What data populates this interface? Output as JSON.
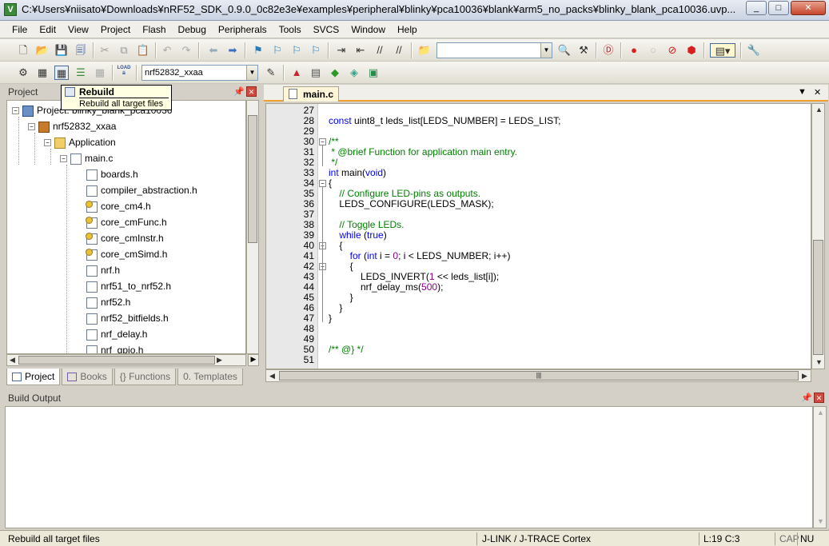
{
  "window": {
    "title": "C:¥Users¥niisato¥Downloads¥nRF52_SDK_0.9.0_0c82e3e¥examples¥peripheral¥blinky¥pca10036¥blank¥arm5_no_packs¥blinky_blank_pca10036.uvp...",
    "app_icon_letter": "V",
    "minimize": "_",
    "maximize": "□",
    "close": "✕"
  },
  "menu": [
    "File",
    "Edit",
    "View",
    "Project",
    "Flash",
    "Debug",
    "Peripherals",
    "Tools",
    "SVCS",
    "Window",
    "Help"
  ],
  "toolbar2": {
    "target_value": "nrf52832_xxaa",
    "load_label": "LOAD"
  },
  "tooltip": {
    "title": "Rebuild",
    "description": "Rebuild all target files"
  },
  "project_pane": {
    "title": "Project",
    "tree": [
      {
        "label": "Project: blinky_blank_pca10036",
        "icon": "project-icon",
        "level": 0,
        "expander": "−"
      },
      {
        "label": "nrf52832_xxaa",
        "icon": "target-icon",
        "level": 1,
        "expander": "−"
      },
      {
        "label": "Application",
        "icon": "folder-icon",
        "level": 2,
        "expander": "−"
      },
      {
        "label": "main.c",
        "icon": "file-icon",
        "level": 3,
        "expander": "−"
      },
      {
        "label": "boards.h",
        "icon": "file-icon",
        "level": 4
      },
      {
        "label": "compiler_abstraction.h",
        "icon": "file-icon",
        "level": 4
      },
      {
        "label": "core_cm4.h",
        "icon": "key-file-icon",
        "level": 4
      },
      {
        "label": "core_cmFunc.h",
        "icon": "key-file-icon",
        "level": 4
      },
      {
        "label": "core_cmInstr.h",
        "icon": "key-file-icon",
        "level": 4
      },
      {
        "label": "core_cmSimd.h",
        "icon": "key-file-icon",
        "level": 4
      },
      {
        "label": "nrf.h",
        "icon": "file-icon",
        "level": 4
      },
      {
        "label": "nrf51_to_nrf52.h",
        "icon": "file-icon",
        "level": 4
      },
      {
        "label": "nrf52.h",
        "icon": "file-icon",
        "level": 4
      },
      {
        "label": "nrf52_bitfields.h",
        "icon": "file-icon",
        "level": 4
      },
      {
        "label": "nrf_delay.h",
        "icon": "file-icon",
        "level": 4
      },
      {
        "label": "nrf_gpio.h",
        "icon": "file-icon",
        "level": 4
      }
    ],
    "tabs": [
      {
        "label": "Project",
        "active": true
      },
      {
        "label": "Books",
        "active": false
      },
      {
        "label": "{} Functions",
        "active": false
      },
      {
        "label": "0. Templates",
        "active": false
      }
    ]
  },
  "editor": {
    "tab_label": "main.c",
    "lines": [
      {
        "n": "27",
        "code": ""
      },
      {
        "n": "28",
        "code": "const uint8_t leds_list[LEDS_NUMBER] = LEDS_LIST;"
      },
      {
        "n": "29",
        "code": ""
      },
      {
        "n": "30",
        "code": "/**",
        "fold": "−",
        "cls": "cm"
      },
      {
        "n": "31",
        "code": " * @brief Function for application main entry.",
        "cls": "cm"
      },
      {
        "n": "32",
        "code": " */",
        "cls": "cm"
      },
      {
        "n": "33",
        "code": "int main(void)",
        "kwfirst": "int",
        "kwrest": " main(",
        "kwmid": "void",
        "kwend": ")"
      },
      {
        "n": "34",
        "code": "{",
        "fold": "−"
      },
      {
        "n": "35",
        "code": "    // Configure LED-pins as outputs.",
        "cls": "cm"
      },
      {
        "n": "36",
        "code": "    LEDS_CONFIGURE(LEDS_MASK);"
      },
      {
        "n": "37",
        "code": ""
      },
      {
        "n": "38",
        "code": "    // Toggle LEDs.",
        "cls": "cm"
      },
      {
        "n": "39",
        "code": "    while (true)",
        "kw2": true
      },
      {
        "n": "40",
        "code": "    {",
        "fold": "−"
      },
      {
        "n": "41",
        "code": "        for (int i = 0; i < LEDS_NUMBER; i++)",
        "kw3": true
      },
      {
        "n": "42",
        "code": "        {",
        "fold": "−"
      },
      {
        "n": "43",
        "code": "            LEDS_INVERT(1 << leds_list[i]);",
        "kw4": true
      },
      {
        "n": "44",
        "code": "            nrf_delay_ms(500);",
        "kw5": true
      },
      {
        "n": "45",
        "code": "        }"
      },
      {
        "n": "46",
        "code": "    }"
      },
      {
        "n": "47",
        "code": "}"
      },
      {
        "n": "48",
        "code": ""
      },
      {
        "n": "49",
        "code": ""
      },
      {
        "n": "50",
        "code": "/** @} */",
        "cls": "cm"
      },
      {
        "n": "51",
        "code": ""
      }
    ]
  },
  "build_output": {
    "title": "Build Output"
  },
  "status": {
    "message": "Rebuild all target files",
    "debugger": "J-LINK / J-TRACE Cortex",
    "position": "L:19 C:3",
    "caps": "CAP",
    "num": "NU"
  },
  "colors": {
    "keyword": "#0000ff",
    "comment": "#008000",
    "number": "#8b008b",
    "active_tab_accent": "#f0a030"
  }
}
